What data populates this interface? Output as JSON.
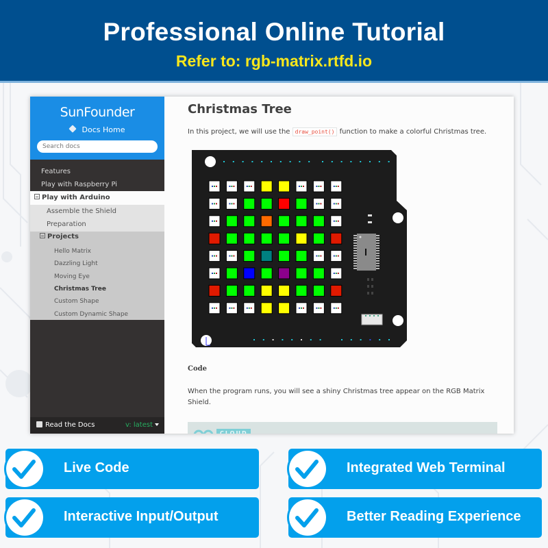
{
  "banner": {
    "title": "Professional Online Tutorial",
    "subtitle": "Refer to: rgb-matrix.rtfd.io"
  },
  "sidebar": {
    "brand": "SunFounder",
    "docs_home": "Docs Home",
    "search_placeholder": "Search docs",
    "top_items": [
      {
        "label": "Features"
      },
      {
        "label": "Play with Raspberry Pi"
      }
    ],
    "open_section": "Play with Arduino",
    "section_items": [
      {
        "label": "Assemble the Shield"
      },
      {
        "label": "Preparation"
      }
    ],
    "subsection": "Projects",
    "projects": [
      {
        "label": "Hello Matrix",
        "current": false
      },
      {
        "label": "Dazzling Light",
        "current": false
      },
      {
        "label": "Moving Eye",
        "current": false
      },
      {
        "label": "Christmas Tree",
        "current": true
      },
      {
        "label": "Custom Shape",
        "current": false
      },
      {
        "label": "Custom Dynamic Shape",
        "current": false
      }
    ],
    "footer": {
      "read_the_docs": "Read the Docs",
      "version": "v: latest"
    }
  },
  "content": {
    "title": "Christmas Tree",
    "intro_before": "In this project, we will use the",
    "intro_code": "draw_point()",
    "intro_after": "function to make a colorful Christmas tree.",
    "code_heading": "Code",
    "code_paragraph": "When the program runs, you will see a shiny Christmas tree appear on the RGB Matrix Shield.",
    "cloud_tag": "CLOUD"
  },
  "matrix": {
    "palette": {
      "W": "#ffffff",
      "Y": "#ffff00",
      "G": "#00ff00",
      "R": "#ff0000",
      "r": "#e01a00",
      "O": "#ff6a00",
      "T": "#008080",
      "B": "#0000ff",
      "P": "#8b008b"
    },
    "rows": [
      "WWWYYWWW",
      "WWGGRGWW",
      "WGGOGGGW",
      "rGGGGYGr",
      "WWGTGGWW",
      "WGBGPGGW",
      "rGGYYGGr",
      "WWWYYWWW"
    ]
  },
  "features": [
    {
      "label": "Live Code"
    },
    {
      "label": "Integrated Web Terminal"
    },
    {
      "label": "Interactive Input/Output"
    },
    {
      "label": "Better Reading Experience"
    }
  ],
  "colors": {
    "banner_bg": "#004f8f",
    "banner_subtitle": "#f8e71c",
    "nav_top": "#1a8de5",
    "nav_bg": "#343131",
    "feature_bg": "#03a0ec",
    "version_green": "#27ae60"
  }
}
